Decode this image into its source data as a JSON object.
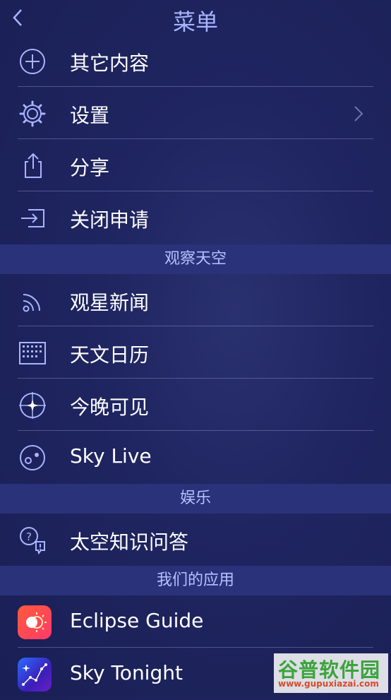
{
  "header": {
    "title": "菜单",
    "back_icon": "chevron-left-icon"
  },
  "menu": [
    {
      "label": "其它内容",
      "icon": "plus-circle-icon"
    },
    {
      "label": "设置",
      "icon": "gear-icon",
      "chevron": "chevron-right-icon"
    },
    {
      "label": "分享",
      "icon": "share-icon"
    },
    {
      "label": "关闭申请",
      "icon": "sign-in-icon"
    }
  ],
  "sections": {
    "observe": {
      "title": "观察天空",
      "items": [
        {
          "label": "观星新闻",
          "icon": "rss-icon"
        },
        {
          "label": "天文日历",
          "icon": "calendar-icon"
        },
        {
          "label": "今晚可见",
          "icon": "star-compass-icon"
        },
        {
          "label": "Sky Live",
          "icon": "planet-icon"
        }
      ]
    },
    "entertainment": {
      "title": "娱乐",
      "items": [
        {
          "label": "太空知识问答",
          "icon": "quiz-bubbles-icon"
        }
      ]
    },
    "apps": {
      "title": "我们的应用",
      "items": [
        {
          "label": "Eclipse Guide",
          "icon": "eclipse-guide-app-icon"
        },
        {
          "label": "Sky Tonight",
          "icon": "sky-tonight-app-icon"
        }
      ]
    }
  },
  "watermark": {
    "line1": "谷普软件园",
    "line2": "www.gupuxiazai.com"
  },
  "colors": {
    "accent": "#a9b4ff",
    "section_bg": "#2a327a",
    "background": "#1f2560"
  }
}
